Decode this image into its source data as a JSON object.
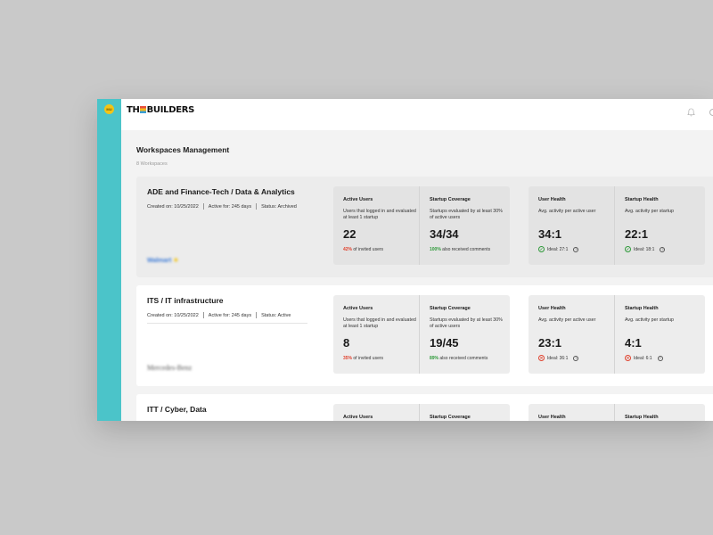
{
  "app": {
    "user_initials": "MU",
    "logo_left": "TH",
    "logo_right": "BUILDERS"
  },
  "page": {
    "title": "Workspaces Management",
    "count": "8 Workspaces"
  },
  "workspaces": [
    {
      "title": "ADE and Finance-Tech / Data & Analytics",
      "created": "Created on: 10/25/2022",
      "active_for": "Active for: 245 days",
      "status": "Status: Archived",
      "client": "Walmart",
      "active_users": {
        "label": "Active Users",
        "desc": "Users that logged in and evaluated at least 1 startup",
        "value": "22",
        "pct": "42%",
        "foot": " of invited users"
      },
      "startup_coverage": {
        "label": "Startup Coverage",
        "desc": "Startups evaluated by at least 30% of active users",
        "value": "34/34",
        "pct": "100%",
        "foot": " also received comments"
      },
      "user_health": {
        "label": "User Health",
        "desc": "Avg. activity per active user",
        "value": "34:1",
        "ideal": "Ideal: 27:1",
        "state": "ok"
      },
      "startup_health": {
        "label": "Startup Health",
        "desc": "Avg. activity per startup",
        "value": "22:1",
        "ideal": "Ideal: 18:1",
        "state": "ok"
      }
    },
    {
      "title": "ITS / IT infrastructure",
      "created": "Created on: 10/25/2022",
      "active_for": "Active for: 245 days",
      "status": "Status: Active",
      "client": "Mercedes-Benz",
      "active_users": {
        "label": "Active Users",
        "desc": "Users that logged in and evaluated at least 1 startup",
        "value": "8",
        "pct": "35%",
        "foot": " of invited users"
      },
      "startup_coverage": {
        "label": "Startup Coverage",
        "desc": "Startups evaluated by at least 30% of active users",
        "value": "19/45",
        "pct": "89%",
        "foot": " also received comments"
      },
      "user_health": {
        "label": "User Health",
        "desc": "Avg. activity per active user",
        "value": "23:1",
        "ideal": "Ideal: 36:1",
        "state": "bad"
      },
      "startup_health": {
        "label": "Startup Health",
        "desc": "Avg. activity per startup",
        "value": "4:1",
        "ideal": "Ideal: 6:1",
        "state": "bad"
      }
    },
    {
      "title": "ITT / Cyber, Data",
      "active_users_label": "Active Users",
      "startup_coverage_label": "Startup Coverage",
      "user_health_label": "User Health",
      "startup_health_label": "Startup Health"
    }
  ],
  "colors": {
    "sidebar": "#4bc4c9",
    "positive": "#2f9a3a",
    "negative": "#e0432f",
    "avatar": "#f2c418"
  }
}
